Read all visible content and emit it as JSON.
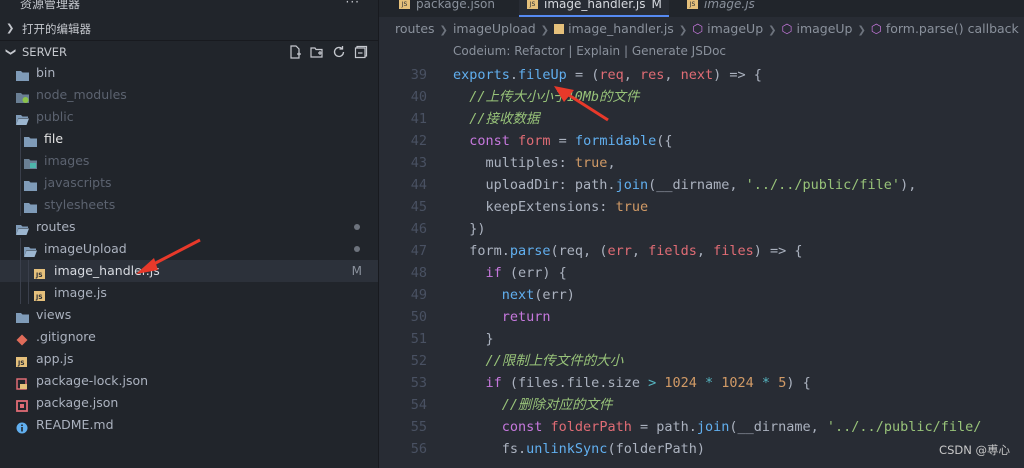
{
  "sidebar": {
    "header_title": "资源管理器",
    "more_label": "···",
    "open_editors_label": "打开的编辑器",
    "project_label": "SERVER",
    "tree": [
      {
        "label": "bin",
        "kind": "folder",
        "indent": 0,
        "tone": "norm"
      },
      {
        "label": "node_modules",
        "kind": "folder-green",
        "indent": 0,
        "tone": "dim"
      },
      {
        "label": "public",
        "kind": "folder-open",
        "indent": 0,
        "tone": "dim"
      },
      {
        "label": "file",
        "kind": "folder",
        "indent": 1,
        "tone": "hl"
      },
      {
        "label": "images",
        "kind": "folder-img",
        "indent": 1,
        "tone": "dim"
      },
      {
        "label": "javascripts",
        "kind": "folder",
        "indent": 1,
        "tone": "dim"
      },
      {
        "label": "stylesheets",
        "kind": "folder",
        "indent": 1,
        "tone": "dim"
      },
      {
        "label": "routes",
        "kind": "folder-open",
        "indent": 0,
        "tone": "norm",
        "dot": true
      },
      {
        "label": "imageUpload",
        "kind": "folder-open",
        "indent": 1,
        "tone": "norm",
        "dot": true
      },
      {
        "label": "image_handler.js",
        "kind": "js",
        "indent": 2,
        "tone": "mod",
        "badge": "M",
        "selected": true
      },
      {
        "label": "image.js",
        "kind": "js",
        "indent": 2,
        "tone": "norm"
      },
      {
        "label": "views",
        "kind": "folder",
        "indent": 0,
        "tone": "norm"
      },
      {
        "label": ".gitignore",
        "kind": "git",
        "indent": 0,
        "tone": "norm"
      },
      {
        "label": "app.js",
        "kind": "js",
        "indent": 0,
        "tone": "norm"
      },
      {
        "label": "package-lock.json",
        "kind": "lock",
        "indent": 0,
        "tone": "norm"
      },
      {
        "label": "package.json",
        "kind": "pkg",
        "indent": 0,
        "tone": "norm"
      },
      {
        "label": "README.md",
        "kind": "info",
        "indent": 0,
        "tone": "norm"
      }
    ]
  },
  "tabs": [
    {
      "label": "package.json",
      "active": false,
      "italic": false
    },
    {
      "label": "image_handler.js",
      "active": true,
      "mark": "M",
      "italic": false
    },
    {
      "label": "image.js",
      "active": false,
      "italic": true
    }
  ],
  "breadcrumb": [
    "routes",
    "imageUpload",
    "image_handler.js",
    "imageUp",
    "imageUp",
    "form.parse() callback"
  ],
  "codelens": "Codeium: Refactor | Explain | Generate JSDoc",
  "code": {
    "line_numbers": [
      "39",
      "40",
      "41",
      "42",
      "43",
      "44",
      "45",
      "46",
      "47",
      "48",
      "49",
      "50",
      "51",
      "52",
      "53",
      "54",
      "55",
      "56"
    ],
    "lines": [
      [
        [
          "f",
          "exports"
        ],
        [
          "p",
          "."
        ],
        [
          "f",
          "fileUp"
        ],
        [
          "p",
          " = ("
        ],
        [
          "v",
          "req"
        ],
        [
          "p",
          ", "
        ],
        [
          "v",
          "res"
        ],
        [
          "p",
          ", "
        ],
        [
          "v",
          "next"
        ],
        [
          "p",
          ") => {"
        ]
      ],
      [
        [
          "cmt",
          "  //上传大小小于10Mb的文件"
        ]
      ],
      [
        [
          "cmt",
          "  //接收数据"
        ]
      ],
      [
        [
          "k",
          "  const "
        ],
        [
          "v",
          "form"
        ],
        [
          "p",
          " = "
        ],
        [
          "f",
          "formidable"
        ],
        [
          "p",
          "({"
        ]
      ],
      [
        [
          "p",
          "    multiples: "
        ],
        [
          "b",
          "true"
        ],
        [
          "p",
          ","
        ]
      ],
      [
        [
          "p",
          "    uploadDir: "
        ],
        [
          "p",
          "path."
        ],
        [
          "f",
          "join"
        ],
        [
          "p",
          "(__dirname, "
        ],
        [
          "s",
          "'../../public/file'"
        ],
        [
          "p",
          "),"
        ]
      ],
      [
        [
          "p",
          "    keepExtensions: "
        ],
        [
          "b",
          "true"
        ]
      ],
      [
        [
          "p",
          "  })"
        ]
      ],
      [
        [
          "p",
          "  form."
        ],
        [
          "f",
          "parse"
        ],
        [
          "p",
          "(req, ("
        ],
        [
          "v",
          "err"
        ],
        [
          "p",
          ", "
        ],
        [
          "v",
          "fields"
        ],
        [
          "p",
          ", "
        ],
        [
          "v",
          "files"
        ],
        [
          "p",
          ") => {"
        ]
      ],
      [
        [
          "k",
          "    if "
        ],
        [
          "p",
          "(err) {"
        ]
      ],
      [
        [
          "f",
          "      next"
        ],
        [
          "p",
          "(err)"
        ]
      ],
      [
        [
          "k",
          "      return"
        ]
      ],
      [
        [
          "p",
          "    }"
        ]
      ],
      [
        [
          "cmt",
          "    //限制上传文件的大小"
        ]
      ],
      [
        [
          "k",
          "    if "
        ],
        [
          "p",
          "(files.file.size "
        ],
        [
          "op",
          ">"
        ],
        [
          "n",
          " 1024 "
        ],
        [
          "op",
          "*"
        ],
        [
          "n",
          " 1024 "
        ],
        [
          "op",
          "*"
        ],
        [
          "n",
          " 5"
        ],
        [
          "p",
          ") {"
        ]
      ],
      [
        [
          "cmt",
          "      //删除对应的文件"
        ]
      ],
      [
        [
          "k",
          "      const "
        ],
        [
          "v",
          "folderPath"
        ],
        [
          "p",
          " = path."
        ],
        [
          "f",
          "join"
        ],
        [
          "p",
          "(__dirname, "
        ],
        [
          "s",
          "'../../public/file/"
        ]
      ],
      [
        [
          "p",
          "      fs."
        ],
        [
          "f",
          "unlinkSync"
        ],
        [
          "p",
          "(folderPath)"
        ]
      ]
    ]
  },
  "watermark": "CSDN @尃心",
  "colors": {
    "accent": "#568af2",
    "arrow": "#e8392a"
  }
}
